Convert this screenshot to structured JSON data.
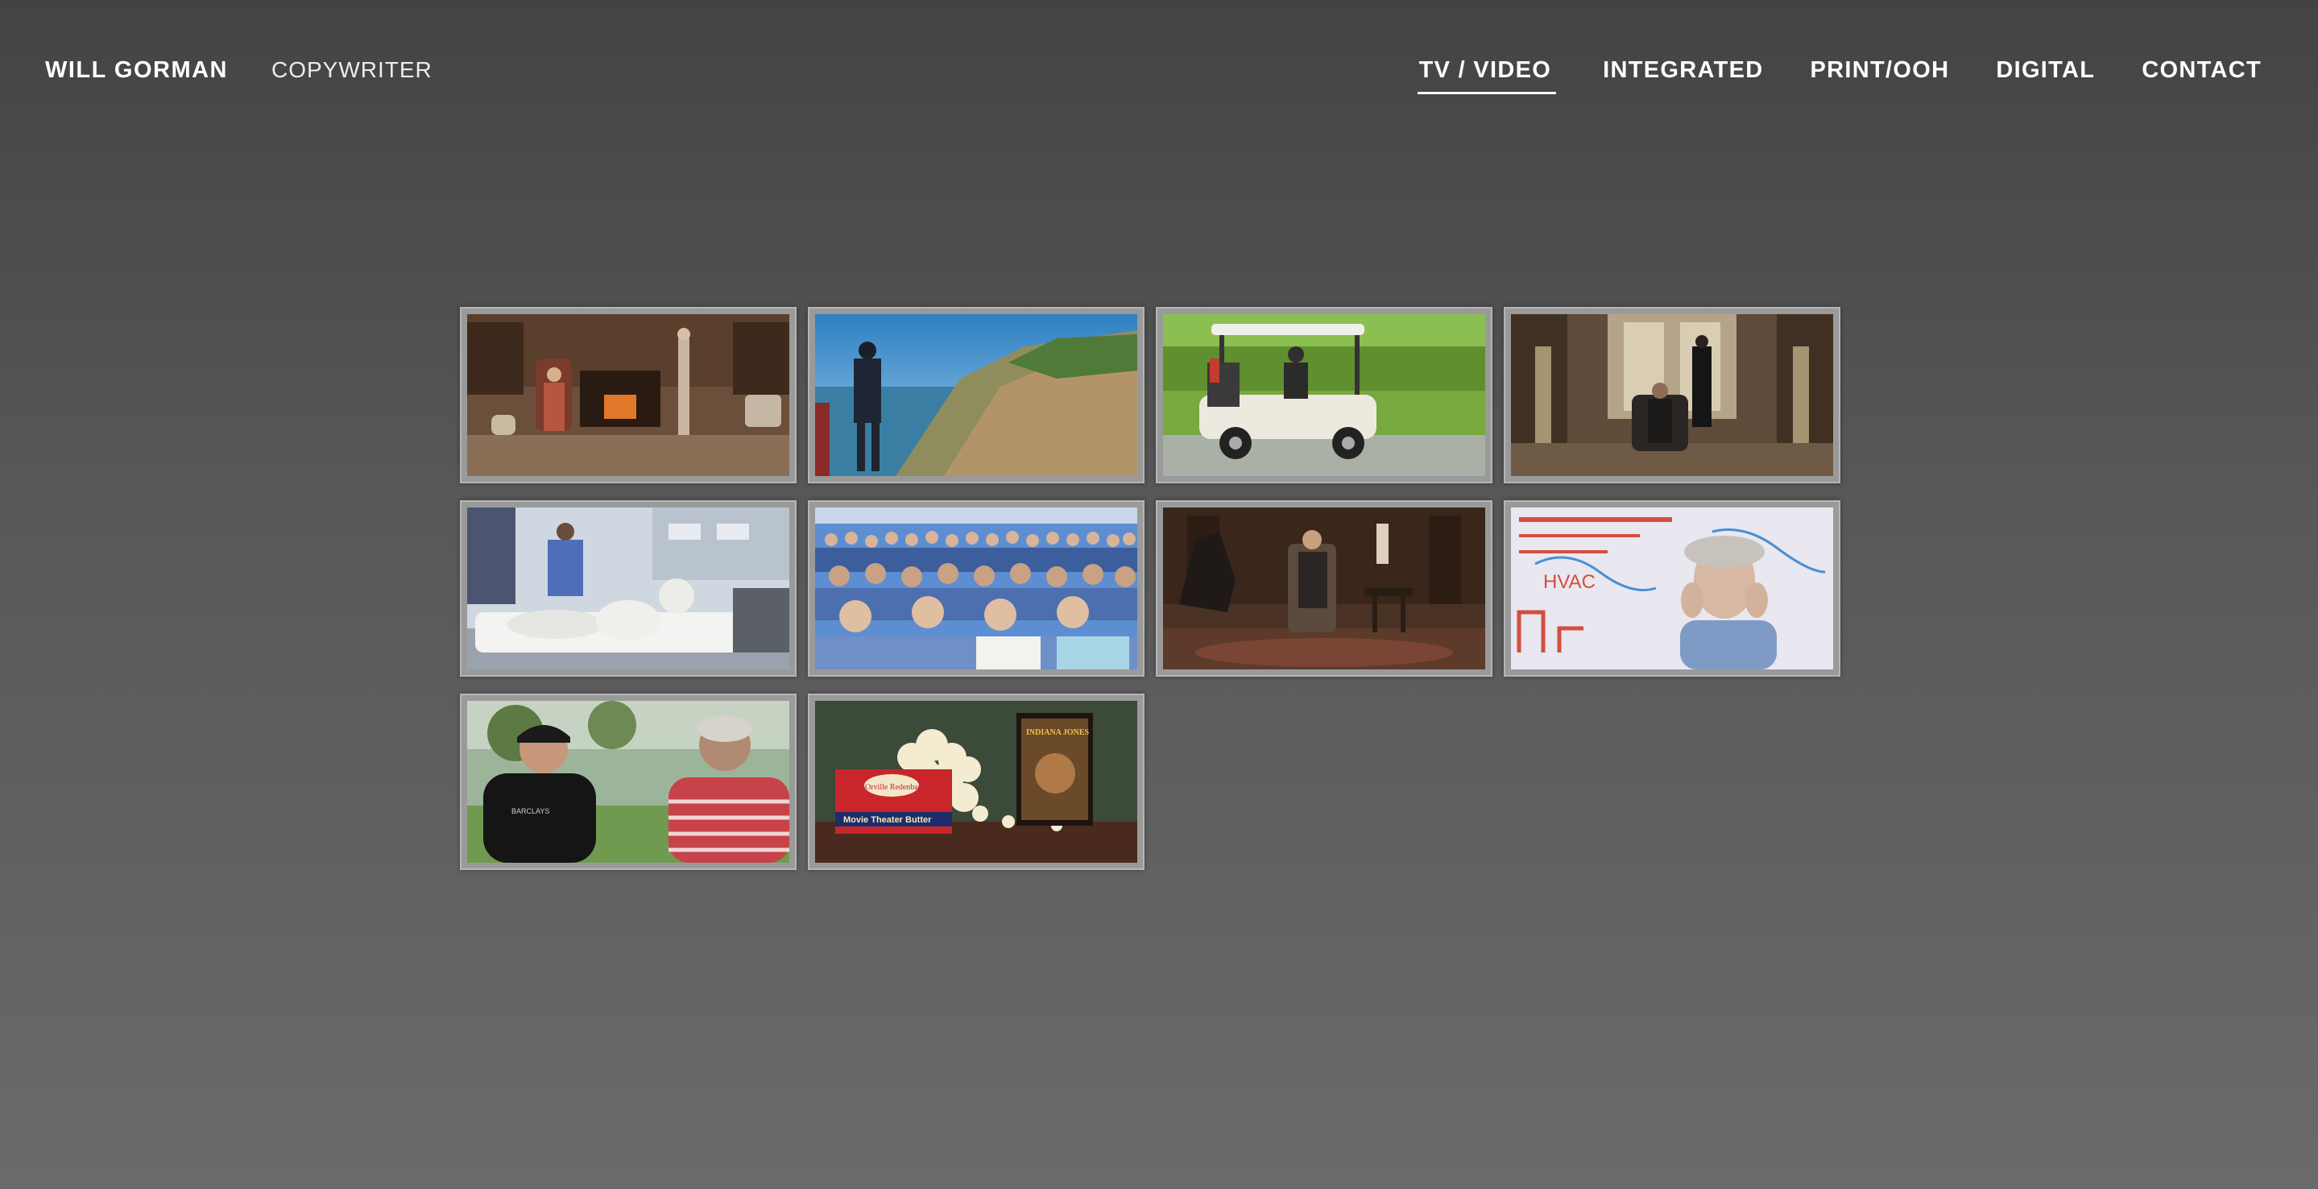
{
  "header": {
    "name": "WILL GORMAN",
    "role": "COPYWRITER"
  },
  "nav": {
    "items": [
      {
        "label": "TV / VIDEO",
        "active": true
      },
      {
        "label": "INTEGRATED",
        "active": false
      },
      {
        "label": "PRINT/OOH",
        "active": false
      },
      {
        "label": "DIGITAL",
        "active": false
      },
      {
        "label": "CONTACT",
        "active": false
      }
    ]
  },
  "thumbs": {
    "popcorn": {
      "box_brand": "Orville Redenbacher's",
      "box_label": "Movie Theater Butter",
      "dvd_title": "INDIANA JONES"
    },
    "whiteboard": {
      "text": "HVAC"
    },
    "golfer": {
      "shirt_text": "BARCLAYS"
    }
  },
  "colors": {
    "background_top": "#434343",
    "background_bottom": "#6a6a6a",
    "thumb_frame": "#9a9a9a",
    "text": "#ffffff"
  }
}
